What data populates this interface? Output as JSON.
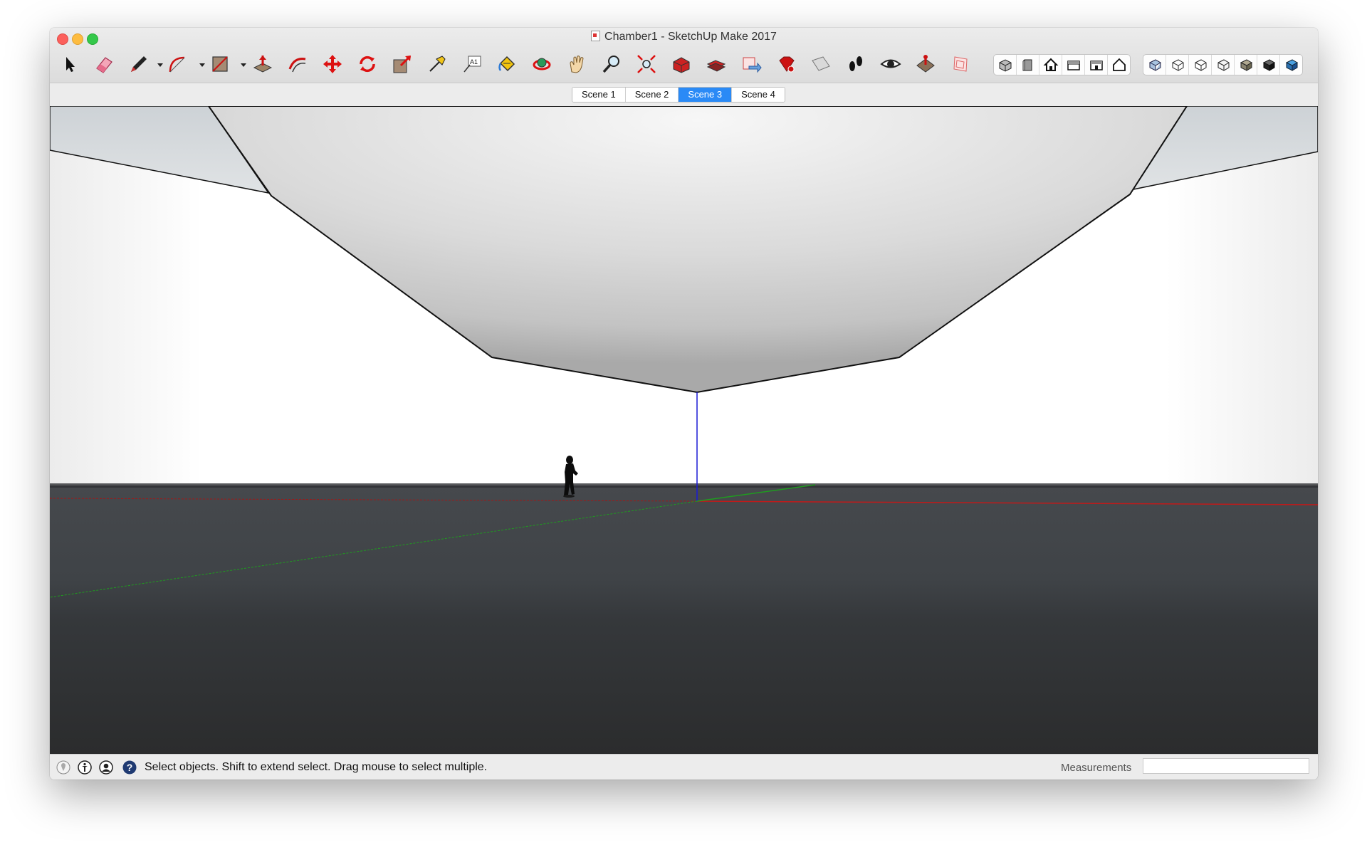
{
  "window": {
    "title": "Chamber1 - SketchUp Make 2017",
    "title_icon": "skp-document-icon"
  },
  "toolbar": {
    "tools": [
      {
        "name": "select-tool",
        "icon": "arrow-icon"
      },
      {
        "name": "eraser-tool",
        "icon": "eraser-icon"
      },
      {
        "name": "line-tool",
        "icon": "pencil-icon",
        "has_menu": true
      },
      {
        "name": "arc-tool",
        "icon": "arc-icon",
        "has_menu": true
      },
      {
        "name": "rectangle-tool",
        "icon": "rectangle-icon",
        "has_menu": true
      },
      {
        "name": "push-pull-tool",
        "icon": "push-pull-icon"
      },
      {
        "name": "offset-tool",
        "icon": "offset-icon"
      },
      {
        "name": "move-tool",
        "icon": "move-icon"
      },
      {
        "name": "rotate-tool",
        "icon": "rotate-icon"
      },
      {
        "name": "scale-tool",
        "icon": "scale-icon"
      },
      {
        "name": "tape-measure-tool",
        "icon": "tape-measure-icon"
      },
      {
        "name": "text-tool",
        "icon": "text-icon"
      },
      {
        "name": "paint-bucket-tool",
        "icon": "paint-bucket-icon"
      },
      {
        "name": "orbit-tool",
        "icon": "orbit-icon"
      },
      {
        "name": "pan-tool",
        "icon": "hand-icon"
      },
      {
        "name": "zoom-tool",
        "icon": "magnifier-icon"
      },
      {
        "name": "zoom-extents-tool",
        "icon": "zoom-extents-icon"
      },
      {
        "name": "3d-warehouse-tool",
        "icon": "warehouse-icon"
      },
      {
        "name": "extension-warehouse-tool",
        "icon": "components-icon"
      },
      {
        "name": "share-model-tool",
        "icon": "share-model-icon"
      },
      {
        "name": "extension-tool",
        "icon": "ruby-icon"
      },
      {
        "name": "section-plane-tool",
        "icon": "section-plane-icon"
      },
      {
        "name": "walk-tool",
        "icon": "footprints-icon"
      },
      {
        "name": "look-around-tool",
        "icon": "eye-icon"
      },
      {
        "name": "position-camera-tool",
        "icon": "position-camera-icon"
      },
      {
        "name": "layout-tool",
        "icon": "layout-icon"
      }
    ],
    "view_buttons": [
      "iso-view-icon",
      "front-view-icon",
      "home-top-view-icon",
      "right-view-icon",
      "back-view-icon",
      "left-view-icon"
    ],
    "style_buttons": [
      "xray-style-icon",
      "wireframe-style-icon",
      "hidden-line-style-icon",
      "shaded-style-icon",
      "shaded-textures-style-icon",
      "monochrome-style-icon",
      "colored-box-style-icon"
    ]
  },
  "scenes": {
    "tabs": [
      "Scene 1",
      "Scene 2",
      "Scene 3",
      "Scene 4"
    ],
    "active_index": 2
  },
  "colors": {
    "accent": "#2a8af6",
    "axis_red": "#c11a1a",
    "axis_green": "#1f9c1f",
    "axis_blue": "#1a1ad6",
    "ground": "#3c4045"
  },
  "status": {
    "icons": [
      "geo-location-icon",
      "credits-icon",
      "user-account-icon",
      "help-icon"
    ],
    "message": "Select objects. Shift to extend select. Drag mouse to select multiple.",
    "measurements_label": "Measurements",
    "measurements_value": ""
  }
}
